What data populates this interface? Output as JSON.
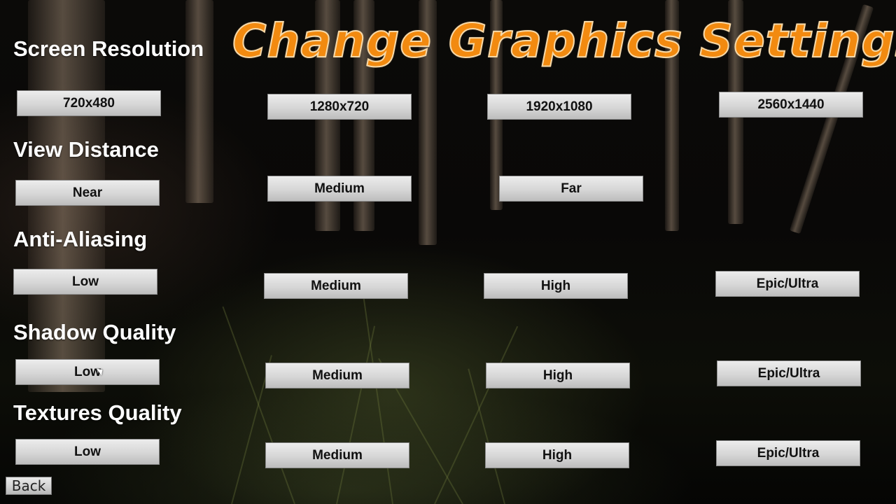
{
  "title": "Change Graphics Settings",
  "colors": {
    "title": "#f28a10",
    "button_bg": "#d6d6d6",
    "label": "#ffffff"
  },
  "sections": {
    "resolution": {
      "label": "Screen Resolution",
      "options": [
        "720x480",
        "1280x720",
        "1920x1080",
        "2560x1440"
      ]
    },
    "view_distance": {
      "label": "View Distance",
      "options": [
        "Near",
        "Medium",
        "Far"
      ]
    },
    "anti_aliasing": {
      "label": "Anti-Aliasing",
      "options": [
        "Low",
        "Medium",
        "High",
        "Epic/Ultra"
      ]
    },
    "shadow_quality": {
      "label": "Shadow Quality",
      "options": [
        "Low",
        "Medium",
        "High",
        "Epic/Ultra"
      ]
    },
    "textures_quality": {
      "label": "Textures Quality",
      "options": [
        "Low",
        "Medium",
        "High",
        "Epic/Ultra"
      ]
    }
  },
  "back_label": "Back",
  "cursor_icon": "mouse-pointer-icon"
}
